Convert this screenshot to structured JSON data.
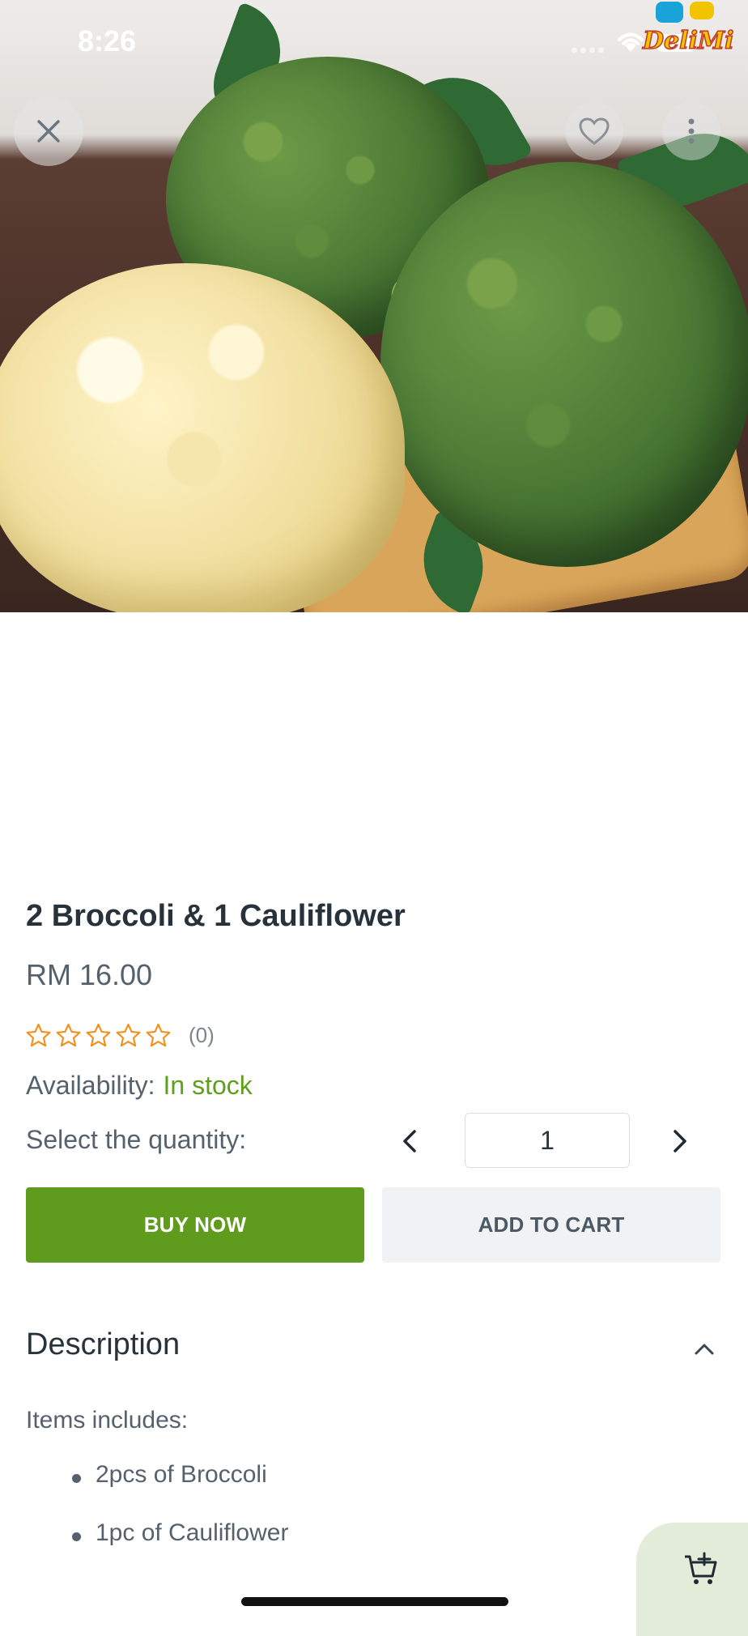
{
  "status_bar": {
    "time": "8:26"
  },
  "brand": {
    "logo_text": "DeliMi"
  },
  "product": {
    "title": "2 Broccoli & 1 Cauliflower",
    "price": "RM 16.00",
    "rating": {
      "stars": 0,
      "max_stars": 5,
      "count_label": "(0)"
    },
    "availability_label": "Availability:",
    "availability_value": "In stock",
    "quantity_label": "Select the quantity:",
    "quantity_value": "1"
  },
  "actions": {
    "buy_now": "BUY NOW",
    "add_to_cart": "ADD TO CART"
  },
  "description": {
    "heading": "Description",
    "intro": "Items includes:",
    "items": [
      "2pcs of Broccoli",
      "1pc of Cauliflower"
    ]
  },
  "icons": {
    "close": "close-icon",
    "favorite": "heart-icon",
    "more": "more-vertical-icon",
    "qty_prev": "chevron-left-icon",
    "qty_next": "chevron-right-icon",
    "collapse": "chevron-up-icon",
    "cart_add": "cart-add-icon"
  },
  "colors": {
    "accent_green": "#5f9b1d",
    "in_stock": "#5f9f1d",
    "star_orange": "#f0901d",
    "text_dark": "#27323b",
    "text_muted": "#55626d",
    "secondary_button": "#f1f2f4",
    "fab_background": "#e3ecd8"
  }
}
